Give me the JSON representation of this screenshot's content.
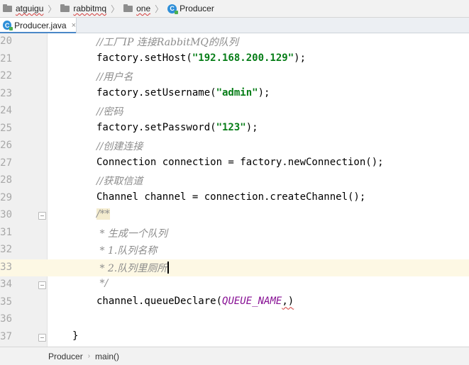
{
  "breadcrumb": {
    "items": [
      {
        "label": "atguigu",
        "icon": "folder-icon"
      },
      {
        "label": "rabbitmq",
        "icon": "folder-icon"
      },
      {
        "label": "one",
        "icon": "folder-icon"
      },
      {
        "label": "Producer",
        "icon": "java-class-icon"
      }
    ]
  },
  "tabs": [
    {
      "label": "Producer.java",
      "icon": "java-class-icon",
      "close": "×",
      "active": true
    }
  ],
  "editor": {
    "current_line": 33,
    "lines": [
      {
        "n": "20",
        "comment": "//工厂IP 连接RabbitMQ的队列"
      },
      {
        "n": "21",
        "pre": "factory.setHost(",
        "str": "\"192.168.200.129\"",
        "post": ");"
      },
      {
        "n": "22",
        "comment": "//用户名"
      },
      {
        "n": "23",
        "pre": "factory.setUsername(",
        "str": "\"admin\"",
        "post": ");"
      },
      {
        "n": "24",
        "comment": "//密码"
      },
      {
        "n": "25",
        "pre": "factory.setPassword(",
        "str": "\"123\"",
        "post": ");"
      },
      {
        "n": "26",
        "comment": "//创建连接"
      },
      {
        "n": "27",
        "text": "Connection connection = factory.newConnection();"
      },
      {
        "n": "28",
        "comment": "//获取信道"
      },
      {
        "n": "29",
        "text": "Channel channel = connection.createChannel();"
      },
      {
        "n": "30",
        "doc_open": "/**"
      },
      {
        "n": "31",
        "comment": " * 生成一个队列"
      },
      {
        "n": "32",
        "comment": " * 1.队列名称"
      },
      {
        "n": "33",
        "comment": " * 2.队列里厕所"
      },
      {
        "n": "34",
        "comment": " */"
      },
      {
        "n": "35",
        "pre": "channel.queueDeclare(",
        "const": "QUEUE_NAME",
        "post": ",)"
      },
      {
        "n": "36",
        "text": ""
      },
      {
        "n": "37",
        "text": "}"
      }
    ]
  },
  "navbar": {
    "class_name": "Producer",
    "separator": "›",
    "method": "main()"
  },
  "colors": {
    "comment": "#8c8c8c",
    "string": "#067d17",
    "constant": "#871094",
    "current_line": "#fdf8e4",
    "gutter": "#f0f0f0"
  }
}
